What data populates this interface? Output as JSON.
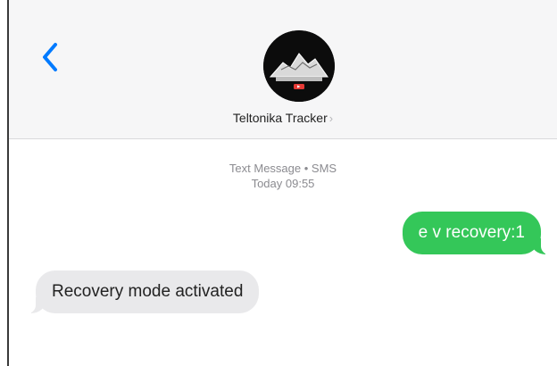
{
  "header": {
    "back_icon": "chevron-left-icon",
    "avatar_icon": "mountain-logo-icon",
    "contact_name": "Teltonika Tracker",
    "contact_chevron": "›"
  },
  "thread": {
    "service_label": "Text Message • SMS",
    "timestamp": "Today 09:55",
    "messages": [
      {
        "direction": "outgoing",
        "text": "e v recovery:1"
      },
      {
        "direction": "incoming",
        "text": "Recovery mode activated"
      }
    ]
  },
  "colors": {
    "accent": "#007aff",
    "outgoing_bubble": "#34c759",
    "incoming_bubble": "#e9e9eb"
  }
}
